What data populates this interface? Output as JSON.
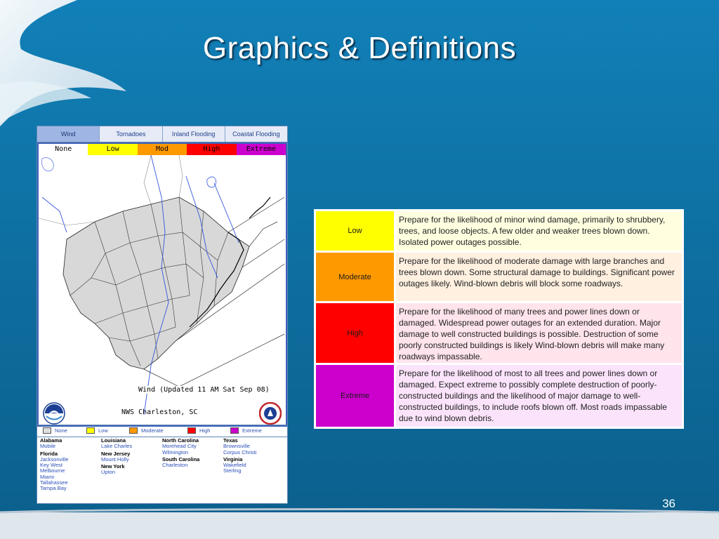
{
  "slide": {
    "title": "Graphics & Definitions",
    "page_number": "36"
  },
  "widget": {
    "tabs": [
      {
        "label": "Wind",
        "active": true
      },
      {
        "label": "Tornadoes",
        "active": false
      },
      {
        "label": "Inland Flooding",
        "active": false
      },
      {
        "label": "Coastal Flooding",
        "active": false
      }
    ],
    "risk_scale": [
      {
        "label": "None",
        "color": "#ffffff"
      },
      {
        "label": "Low",
        "color": "#ffff00"
      },
      {
        "label": "Mod",
        "color": "#ff9900"
      },
      {
        "label": "High",
        "color": "#ff0000"
      },
      {
        "label": "Extreme",
        "color": "#cc00cc"
      }
    ],
    "map_caption": "Wind (Updated  11 AM Sat Sep 08)",
    "office_name": "NWS Charleston, SC",
    "legend": [
      {
        "label": "None",
        "color": "#dddddd"
      },
      {
        "label": "Low",
        "color": "#ffff00"
      },
      {
        "label": "Moderate",
        "color": "#ff9900"
      },
      {
        "label": "High",
        "color": "#ff0000"
      },
      {
        "label": "Extreme",
        "color": "#cc00cc"
      }
    ],
    "offices": [
      [
        {
          "state": "Alabama",
          "cities": [
            "Mobile"
          ]
        },
        {
          "state": "Florida",
          "cities": [
            "Jacksonville",
            "Key West",
            "Melbourne",
            "Miami",
            "Tallahassee",
            "Tampa Bay"
          ]
        }
      ],
      [
        {
          "state": "Louisiana",
          "cities": [
            "Lake Charles"
          ]
        },
        {
          "state": "New Jersey",
          "cities": [
            "Mount Holly"
          ]
        },
        {
          "state": "New York",
          "cities": [
            "Upton"
          ]
        }
      ],
      [
        {
          "state": "North Carolina",
          "cities": [
            "Morehead City",
            "Wilmington"
          ]
        },
        {
          "state": "South Carolina",
          "cities": [
            "Charleston"
          ]
        }
      ],
      [
        {
          "state": "Texas",
          "cities": [
            "Brownsville",
            "Corpus Christi"
          ]
        },
        {
          "state": "Virginia",
          "cities": [
            "Wakefield",
            "Sterling"
          ]
        }
      ]
    ]
  },
  "definitions": [
    {
      "level": "Low",
      "color": "#ffff00",
      "bg": "#ffffe0",
      "text": "Prepare for the likelihood of minor wind damage, primarily to shrubbery, trees, and loose objects. A few older and weaker trees blown down. Isolated power outages possible."
    },
    {
      "level": "Moderate",
      "color": "#ff9900",
      "bg": "#fff0e0",
      "text": "Prepare for the likelihood of moderate damage with large branches and trees blown down. Some structural damage to buildings. Significant power outages likely. Wind-blown debris will block some roadways."
    },
    {
      "level": "High",
      "color": "#ff0000",
      "bg": "#ffe4ec",
      "text": "Prepare for the likelihood of many trees and power lines down or damaged. Widespread power outages for an extended duration. Major damage to well constructed buildings is possible. Destruction of some poorly constructed buildings is likely Wind-blown debris will make many roadways impassable."
    },
    {
      "level": "Extreme",
      "color": "#cc00cc",
      "bg": "#fbe4fb",
      "text": "Prepare for the likelihood of most to all trees and power lines down or damaged. Expect extreme to possibly complete destruction of poorly-constructed buildings and the likelihood of major damage to well-constructed buildings, to include roofs blown off. Most roads impassable due to wind blown debris."
    }
  ]
}
